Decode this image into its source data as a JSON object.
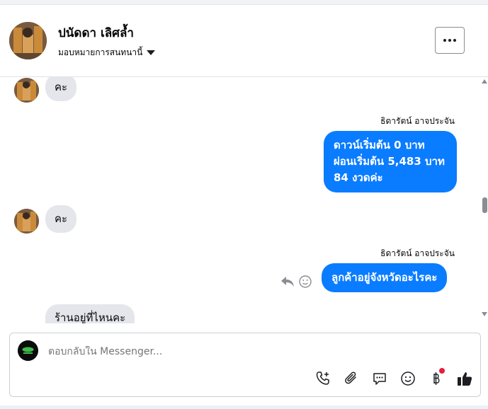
{
  "header": {
    "contact_name": "ปนัดดา เลิศล้ำ",
    "assign_label": "มอบหมายการสนทนานี้"
  },
  "messages": [
    {
      "type": "incoming",
      "text": "คะ"
    },
    {
      "type": "outgoing",
      "sender": "ธิดารัตน์ อาจประจัน",
      "lines": [
        "ดาวน์เริ่มต้น 0 บาท",
        "ผ่อนเริ่มต้น 5,483 บาท",
        "84 งวดค่ะ"
      ]
    },
    {
      "type": "incoming",
      "text": "คะ"
    },
    {
      "type": "outgoing",
      "sender": "ธิดารัตน์ อาจประจัน",
      "text": "ลูกค้าอยู่จังหวัดอะไรคะ"
    },
    {
      "type": "incoming",
      "text": "ร้านอยู่ที่ไหนคะ"
    }
  ],
  "composer": {
    "placeholder": "ตอบกลับใน Messenger...",
    "tools": [
      "phone-add-icon",
      "paperclip-icon",
      "saved-replies-icon",
      "emoji-icon",
      "baht-icon",
      "like-icon"
    ]
  },
  "colors": {
    "outgoing_bubble": "#0a7cff",
    "incoming_bubble": "#e4e6eb",
    "notification_dot": "#e41e3f"
  }
}
